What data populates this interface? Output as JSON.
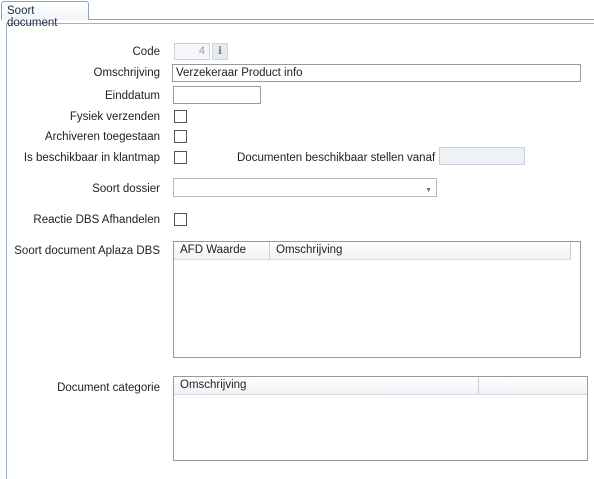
{
  "tab": {
    "label": "Soort document"
  },
  "fields": {
    "code": {
      "label": "Code",
      "value": "4"
    },
    "omschrijving": {
      "label": "Omschrijving",
      "value": "Verzekeraar Product info"
    },
    "einddatum": {
      "label": "Einddatum",
      "value": ""
    },
    "fysiek_verzenden": {
      "label": "Fysiek verzenden",
      "checked": false
    },
    "archiveren": {
      "label": "Archiveren toegestaan",
      "checked": false
    },
    "beschikbaar_klantmap": {
      "label": "Is beschikbaar in klantmap",
      "checked": false
    },
    "beschikbaar_vanaf": {
      "label": "Documenten beschikbaar stellen vanaf",
      "value": ""
    },
    "soort_dossier": {
      "label": "Soort dossier",
      "value": ""
    },
    "reactie_dbs": {
      "label": "Reactie DBS Afhandelen",
      "checked": false
    }
  },
  "aplaza_grid": {
    "label": "Soort document Aplaza DBS",
    "columns": [
      "AFD Waarde",
      "Omschrijving"
    ],
    "rows": []
  },
  "categorie_grid": {
    "label": "Document categorie",
    "columns": [
      "Omschrijving"
    ],
    "rows": []
  },
  "icons": {
    "info": "info-icon",
    "dropdown": "chevron-down-icon"
  }
}
